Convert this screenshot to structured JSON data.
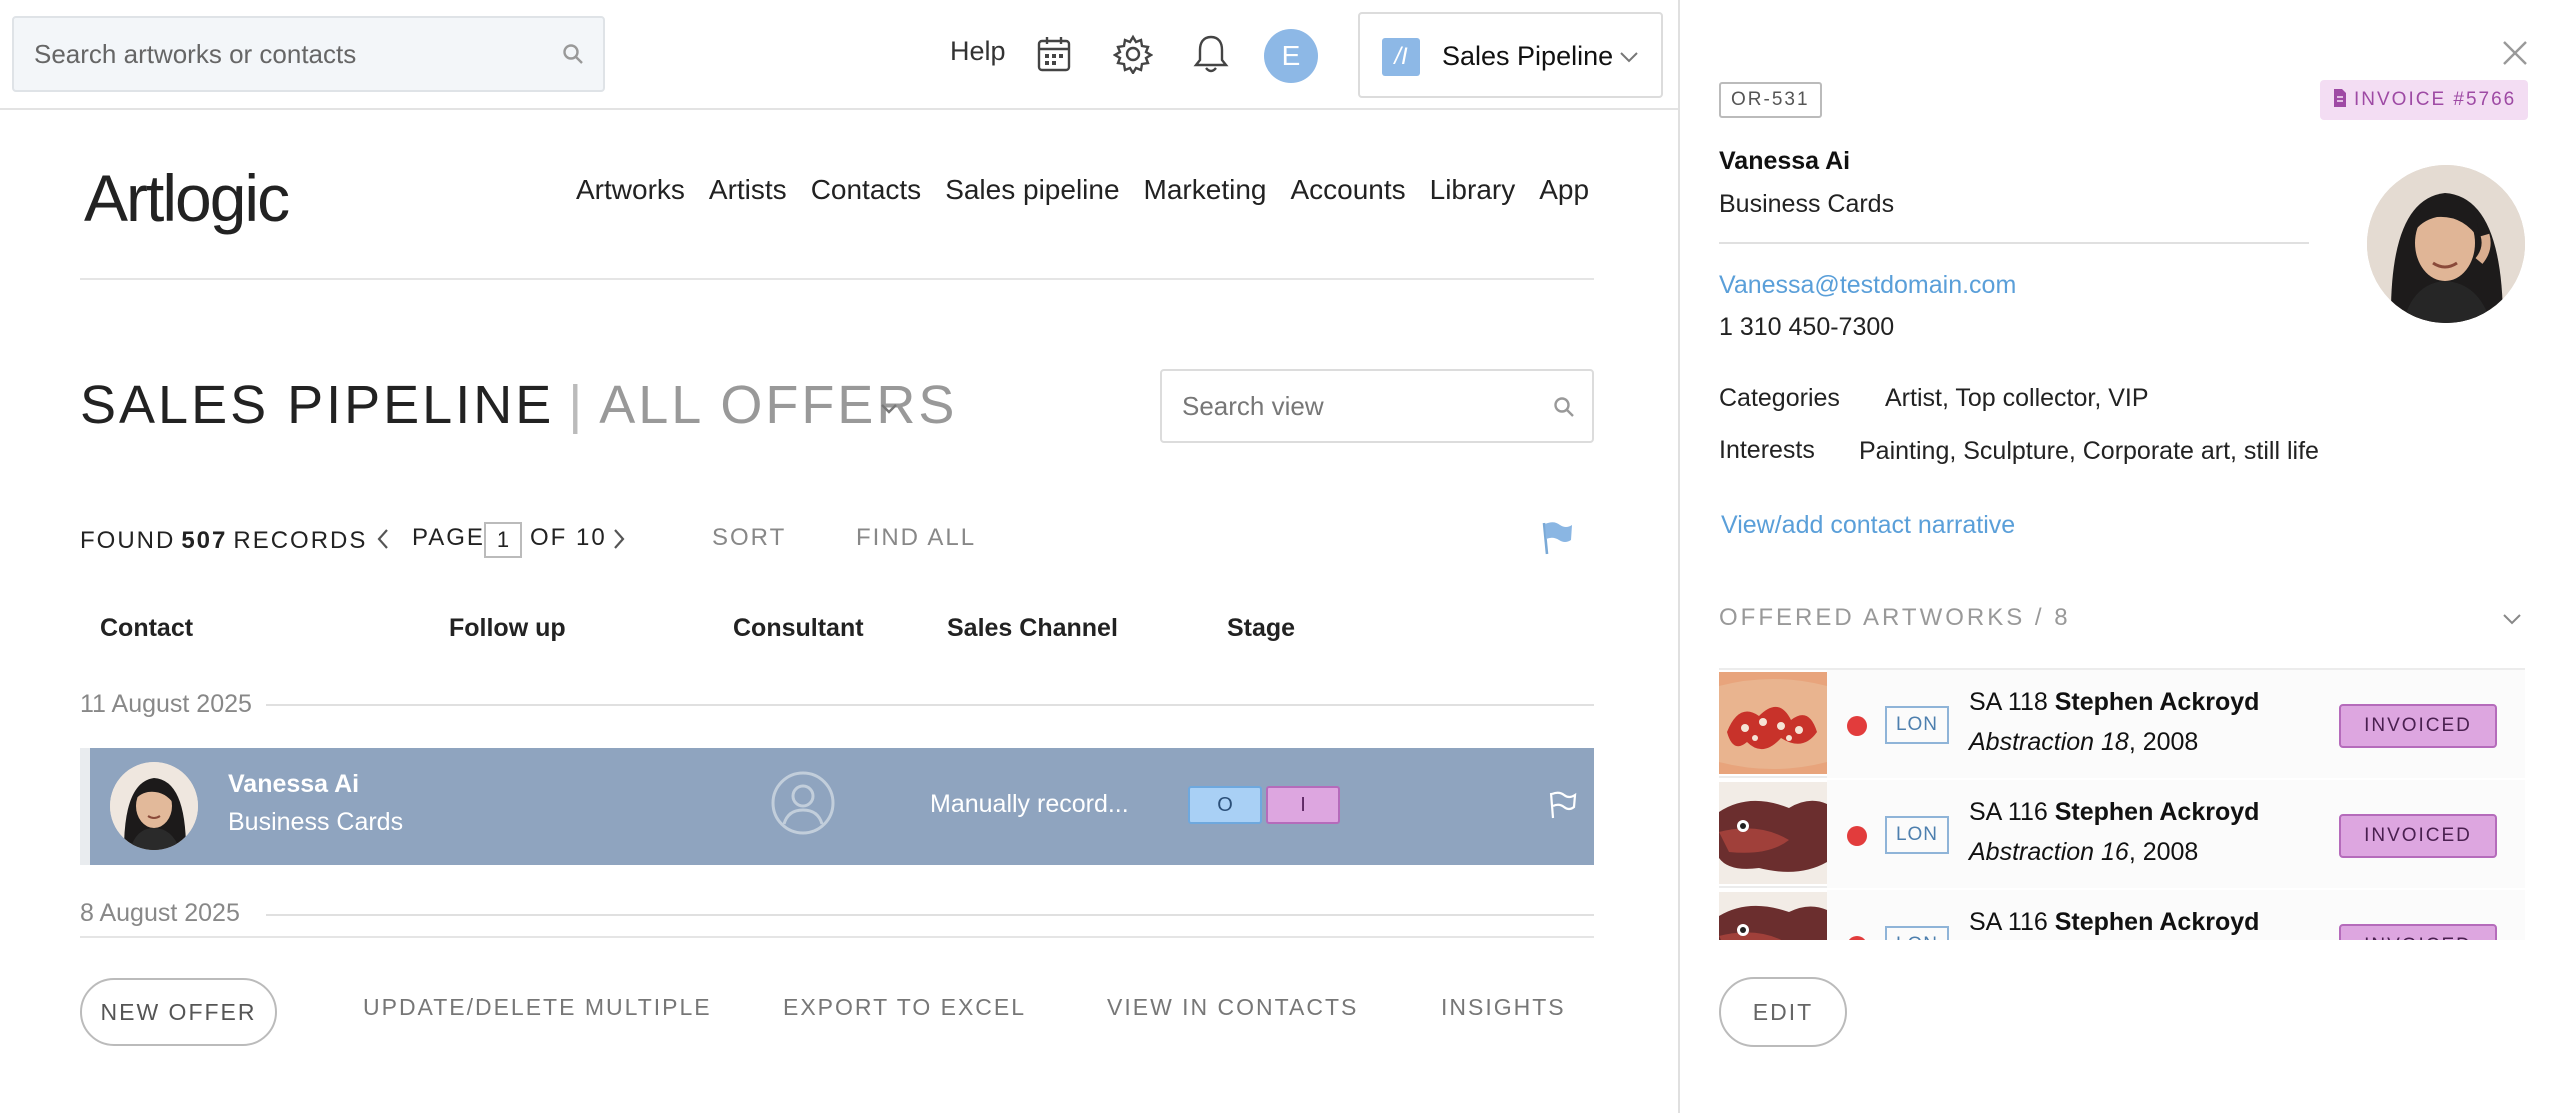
{
  "topbar": {
    "search_placeholder": "Search artworks or contacts",
    "help_label": "Help",
    "avatar_initial": "E",
    "module_label": "Sales Pipeline",
    "module_logo": "/I"
  },
  "brand": {
    "logo_text": "Artlogic"
  },
  "nav": [
    "Artworks",
    "Artists",
    "Contacts",
    "Sales pipeline",
    "Marketing",
    "Accounts",
    "Library",
    "App"
  ],
  "header": {
    "title": "SALES PIPELINE",
    "separator": "|",
    "subtitle": "ALL OFFERS",
    "search_placeholder": "Search view"
  },
  "toolbar": {
    "found_label": "FOUND",
    "record_count": "507",
    "records_label": "RECORDS",
    "page_label": "PAGE",
    "page_current": "1",
    "page_of": "OF 10",
    "sort_label": "SORT",
    "findall_label": "FIND ALL"
  },
  "table": {
    "columns": [
      "Contact",
      "Follow up",
      "Consultant",
      "Sales Channel",
      "Stage"
    ],
    "groups": [
      {
        "date": "11 August 2025",
        "rows": [
          {
            "name": "Vanessa Ai",
            "org": "Business Cards",
            "channel": "Manually record...",
            "stages": [
              "O",
              "I"
            ]
          }
        ]
      },
      {
        "date": "8 August 2025",
        "rows": []
      }
    ]
  },
  "actions": {
    "new_offer": "NEW OFFER",
    "update_delete": "UPDATE/DELETE MULTIPLE",
    "export": "EXPORT TO EXCEL",
    "view_contacts": "VIEW IN CONTACTS",
    "insights": "INSIGHTS"
  },
  "panel": {
    "ref": "OR-531",
    "invoice": "INVOICE #5766",
    "name": "Vanessa Ai",
    "org": "Business Cards",
    "email": "Vanessa@testdomain.com",
    "phone": "1 310 450-7300",
    "categories_label": "Categories",
    "categories_value": "Artist, Top collector, VIP",
    "interests_label": "Interests",
    "interests_value": "Painting, Sculpture, Corporate art, still life",
    "narrative_link": "View/add contact narrative",
    "offered_header": "OFFERED ARTWORKS / 8",
    "artworks": [
      {
        "location": "LON",
        "ref": "SA 118",
        "artist": "Stephen Ackroyd",
        "title": "Abstraction 18",
        "year": ", 2008",
        "status": "INVOICED"
      },
      {
        "location": "LON",
        "ref": "SA 116",
        "artist": "Stephen Ackroyd",
        "title": "Abstraction 16",
        "year": ", 2008",
        "status": "INVOICED"
      },
      {
        "location": "LON",
        "ref": "SA 116",
        "artist": "Stephen Ackroyd",
        "title": "",
        "year": "",
        "status": "INVOICED"
      }
    ],
    "edit_label": "EDIT"
  },
  "colors": {
    "accent_blue": "#5a9fd9",
    "selected_row": "#8fa4bf",
    "invoiced_pink": "#dda6e0",
    "status_dot_red": "#e23c3c"
  },
  "icons": [
    "search-icon",
    "calendar-icon",
    "gear-icon",
    "bell-icon",
    "chevron-down-icon",
    "chevron-left-icon",
    "chevron-right-icon",
    "flag-icon",
    "user-placeholder-icon",
    "close-icon",
    "invoice-doc-icon"
  ]
}
